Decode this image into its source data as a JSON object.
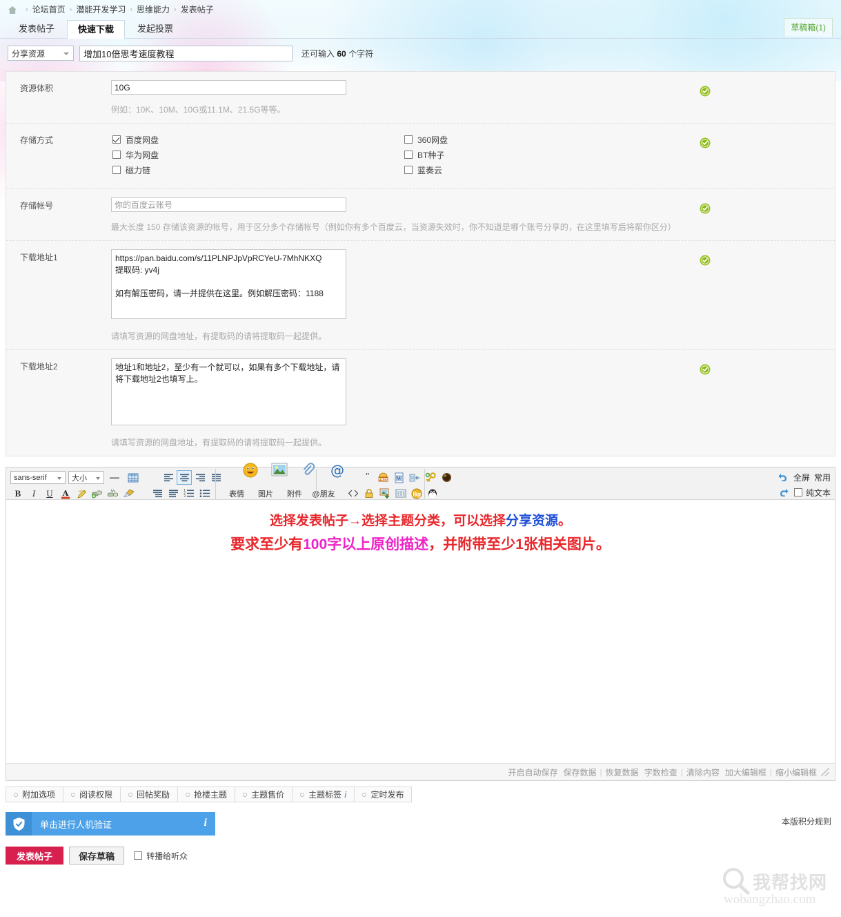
{
  "breadcrumb": {
    "home_icon": "home-icon",
    "items": [
      "论坛首页",
      "潜能开发学习",
      "思维能力",
      "发表帖子"
    ],
    "separator": "›"
  },
  "tabs": [
    {
      "label": "发表帖子",
      "active": false
    },
    {
      "label": "快速下载",
      "active": true
    },
    {
      "label": "发起投票",
      "active": false
    }
  ],
  "draftbox": {
    "label": "草稿箱(1)",
    "color": "#5aa832"
  },
  "title_row": {
    "type_select_value": "分享资源",
    "subject_value": "增加10倍思考速度教程",
    "hint_prefix": "还可输入",
    "hint_count": "60",
    "hint_suffix": "个字符"
  },
  "form": {
    "size": {
      "label": "资源体积",
      "value": "10G",
      "hint": "例如：10K、10M、10G或11.1M、21.5G等等。",
      "status": "valid"
    },
    "storage": {
      "label": "存储方式",
      "status": "valid",
      "left_options": [
        {
          "label": "百度网盘",
          "checked": true
        },
        {
          "label": "华为网盘",
          "checked": false
        },
        {
          "label": "磁力链",
          "checked": false
        }
      ],
      "right_options": [
        {
          "label": "360网盘",
          "checked": false
        },
        {
          "label": "BT种子",
          "checked": false
        },
        {
          "label": "蓝奏云",
          "checked": false
        }
      ]
    },
    "account": {
      "label": "存储帐号",
      "placeholder": "你的百度云账号",
      "value": "",
      "hint": "最大长度 150  存储该资源的帐号，用于区分多个存储帐号（例如你有多个百度云，当资源失效时，你不知道是哪个账号分享的，在这里填写后将帮你区分）",
      "status": "valid"
    },
    "url1": {
      "label": "下载地址1",
      "value": "https://pan.baidu.com/s/11PLNPJpVpRCYeU-7MhNKXQ\n提取码: yv4j\n\n如有解压密码，请一并提供在这里。例如解压密码：1188",
      "hint": "请填写资源的网盘地址，有提取码的请将提取码一起提供。",
      "status": "valid"
    },
    "url2": {
      "label": "下载地址2",
      "value": "地址1和地址2，至少有一个就可以，如果有多个下载地址，请将下载地址2也填写上。",
      "hint": "请填写资源的网盘地址，有提取码的请将提取码一起提供。",
      "status": "valid"
    }
  },
  "toolbar": {
    "font_value": "sans-serif",
    "size_value": "大小",
    "row1_icons": [
      "horizontal-rule-icon",
      "table-icon"
    ],
    "align_icons": [
      "align-left-icon",
      "align-center-icon",
      "align-right-icon",
      "align-justify-icon"
    ],
    "align_icons2": [
      "indent-decrease-icon",
      "indent-increase-icon",
      "ordered-list-icon",
      "unordered-list-icon"
    ],
    "format_icons": [
      "bold-icon",
      "italic-icon",
      "underline-icon",
      "font-color-icon",
      "highlight-icon",
      "insert-link-icon",
      "remove-link-icon",
      "clear-format-icon"
    ],
    "big_buttons": [
      {
        "label": "表情",
        "icon": "smiley-icon"
      },
      {
        "label": "图片",
        "icon": "image-icon"
      },
      {
        "label": "附件",
        "icon": "paperclip-icon"
      },
      {
        "label": "@朋友",
        "icon": "at-icon"
      }
    ],
    "extra_row1": [
      "quote-icon",
      "free-icon",
      "word-icon",
      "hr-icon",
      "key-icon",
      "globe-icon"
    ],
    "extra_row2": [
      "code-icon",
      "lock-icon",
      "image-save-icon",
      "columns-icon",
      "background-icon",
      "qq-icon"
    ],
    "undo_icon": "undo-icon",
    "redo_icon": "redo-icon",
    "fullscreen_label": "全屏",
    "common_label": "常用",
    "plaintext_label": "纯文本",
    "plaintext_checked": false
  },
  "editor_content": {
    "line1_a": "选择发表帖子→选择主题分类，可以选择",
    "line1_b": "分享资源",
    "line1_c": "。",
    "line2_a": "要求至少有",
    "line2_b": "100字以上原创描述",
    "line2_c": "，并附带至少1张相关图片。"
  },
  "editor_footer": {
    "autosave": "开启自动保存",
    "save_data": "保存数据",
    "restore_data": "恢复数据",
    "word_count": "字数检查",
    "clear_content": "清除内容",
    "enlarge": "加大编辑框",
    "shrink": "缩小编辑框",
    "divider": "|"
  },
  "options": [
    {
      "label": "附加选项"
    },
    {
      "label": "阅读权限"
    },
    {
      "label": "回帖奖励"
    },
    {
      "label": "抢楼主题"
    },
    {
      "label": "主题售价"
    },
    {
      "label": "主题标签",
      "italic": "i"
    },
    {
      "label": "定时发布"
    }
  ],
  "captcha": {
    "label": "单击进行人机验证",
    "info": "i",
    "icon": "shield-check-icon",
    "bg_color": "#4da1e8"
  },
  "rule_link": "本版积分规则",
  "submit": {
    "post_label": "发表帖子",
    "post_color": "#d8204f",
    "draft_label": "保存草稿",
    "broadcast_label": "转播给听众",
    "broadcast_checked": false
  },
  "watermark": {
    "brand": "我帮找网",
    "domain": "wobangzhao.com",
    "icon": "magnifier-icon"
  }
}
